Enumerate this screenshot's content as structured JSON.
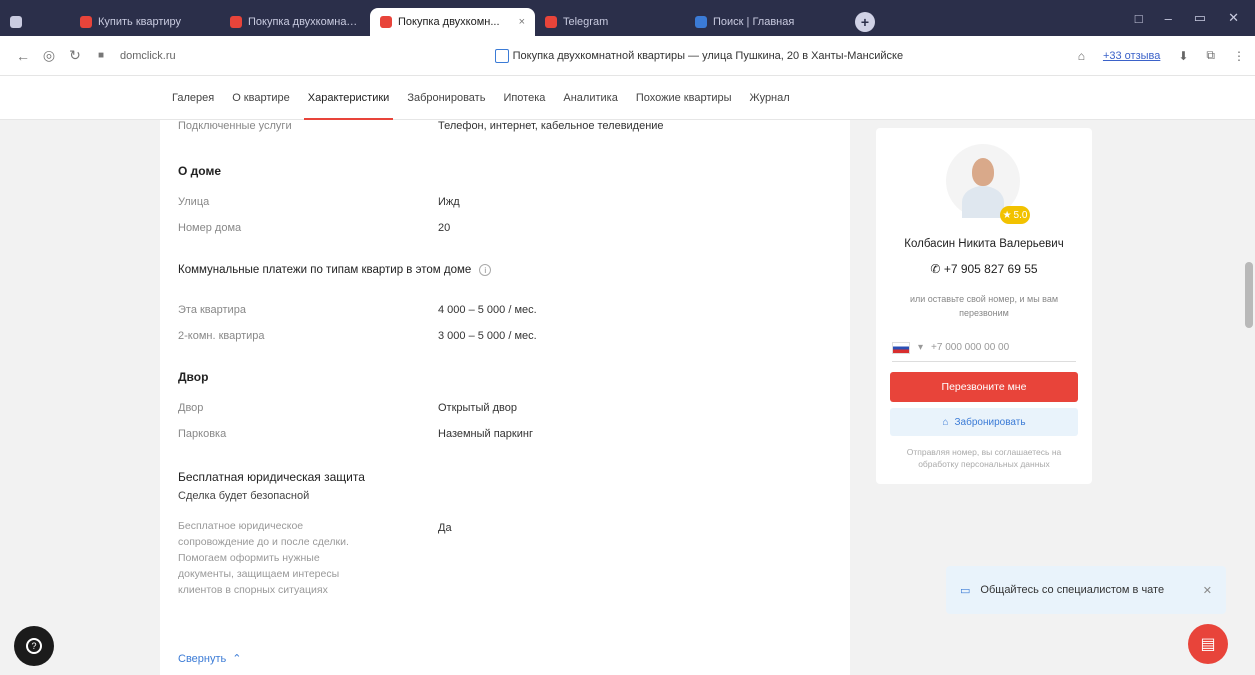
{
  "browser": {
    "tabs": [
      {
        "label": "Купить квартиру",
        "color": "#e8443a",
        "active": false
      },
      {
        "label": "Покупка двухкомнатной",
        "color": "#e8443a",
        "active": false
      },
      {
        "label": "Покупка двухкомн...",
        "color": "#e8443a",
        "active": true
      },
      {
        "label": "Telegram",
        "color": "#e8443a",
        "active": false
      },
      {
        "label": "Поиск | Главная",
        "color": "#3b7bd6",
        "active": false
      }
    ],
    "window_controls": [
      "□",
      "–",
      "▭",
      "✕"
    ],
    "url": "domclick.ru",
    "page_title": "Покупка двухкомнатной квартиры — улица Пушкина, 20 в Ханты-Мансийске",
    "addr_link": "+33 отзыва"
  },
  "site_nav": {
    "items": [
      {
        "label": "Галерея",
        "active": false
      },
      {
        "label": "О квартире",
        "active": false
      },
      {
        "label": "Характеристики",
        "active": true
      },
      {
        "label": "Забронировать",
        "active": false
      },
      {
        "label": "Ипотека",
        "active": false
      },
      {
        "label": "Аналитика",
        "active": false
      },
      {
        "label": "Похожие квартиры",
        "active": false
      },
      {
        "label": "Журнал",
        "active": false
      }
    ]
  },
  "main": {
    "top_row": {
      "label": "Подключенные услуги",
      "value": "Телефон, интернет, кабельное телевидение"
    },
    "house": {
      "title": "О доме",
      "rows": [
        {
          "label": "Улица",
          "value": "Ижд"
        },
        {
          "label": "Номер дома",
          "value": "20"
        }
      ]
    },
    "utilities": {
      "title": "Коммунальные платежи по типам квартир в этом доме",
      "rows": [
        {
          "label": "Эта квартира",
          "value": "4 000 – 5 000 / мес."
        },
        {
          "label": "2-комн. квартира",
          "value": "3 000 – 5 000 / мес."
        }
      ]
    },
    "yard": {
      "title": "Двор",
      "rows": [
        {
          "label": "Двор",
          "value": "Открытый двор"
        },
        {
          "label": "Парковка",
          "value": "Наземный паркинг"
        }
      ]
    },
    "legal": {
      "title": "Бесплатная юридическая защита",
      "subtitle": "Сделка будет безопасной",
      "description": "Бесплатное юридическое сопровождение до и после сделки. Помогаем оформить нужные документы, защищаем интересы клиентов в спорных ситуациях",
      "value": "Да"
    },
    "collapse_label": "Свернуть"
  },
  "agent": {
    "rating": "5.0",
    "name": "Колбасин Никита Валерьевич",
    "phone": "+7 905 827 69 55",
    "note": "или оставьте свой номер, и мы вам перезвоним",
    "phone_placeholder": "+7 000 000 00 00",
    "callback_label": "Перезвоните мне",
    "favorite_label": "Забронировать",
    "consent": "Отправляя номер, вы соглашаетесь на обработку персональных данных"
  },
  "chat": {
    "popup_label": "Общайтесь со специалистом в чате"
  }
}
